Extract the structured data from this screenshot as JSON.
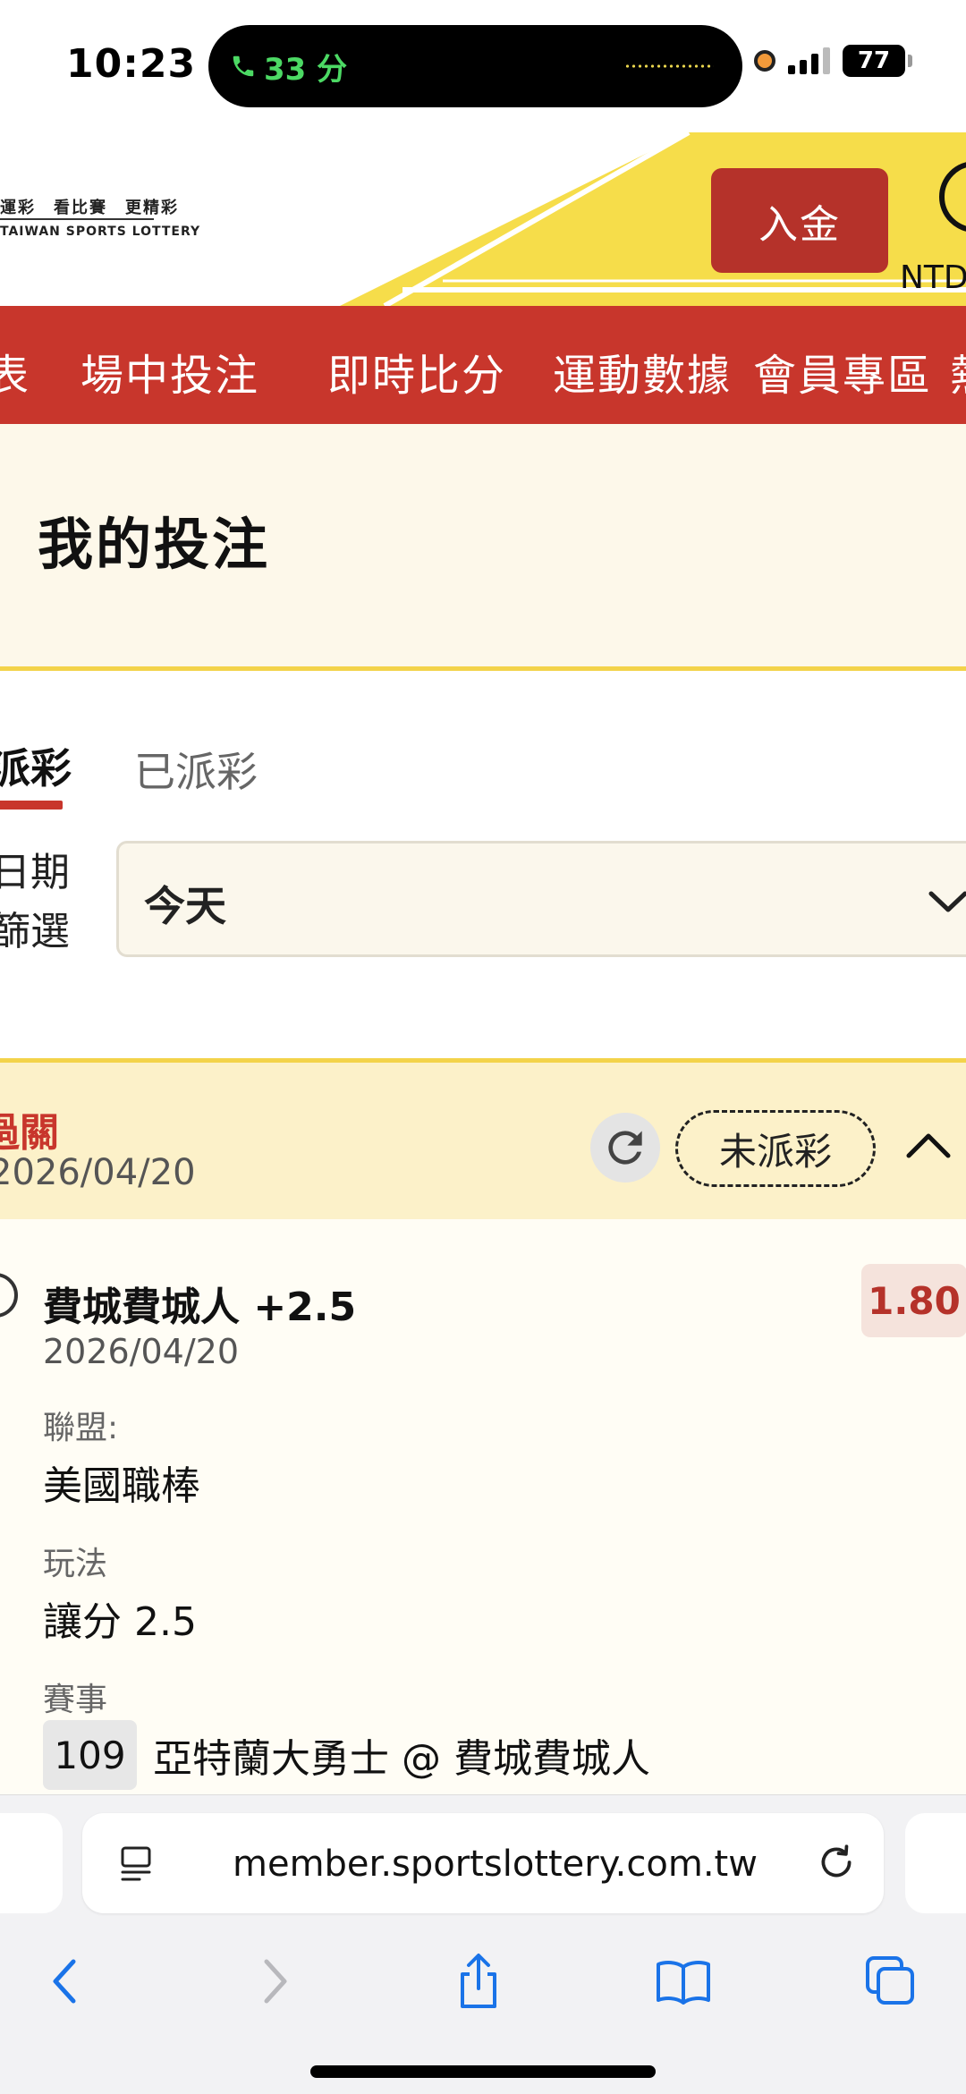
{
  "status_bar": {
    "time": "10:23",
    "call_duration": "33 分",
    "battery": "77"
  },
  "header": {
    "logo_top": "運彩　看比賽　更精彩",
    "logo_bottom": "TAIWAN SPORTS LOTTERY",
    "deposit_label": "入金",
    "currency": "NTD"
  },
  "nav": {
    "items": [
      "表",
      "場中投注",
      "即時比分",
      "運動數據",
      "會員專區",
      "熱"
    ]
  },
  "page": {
    "title": "我的投注"
  },
  "tabs": {
    "active_label": "派彩",
    "inactive_label": "已派彩"
  },
  "filter": {
    "label_line1": "日期",
    "label_line2": "篩選",
    "selected": "今天"
  },
  "bet": {
    "type": "過關",
    "date": "2026/04/20",
    "status": "未派彩",
    "selection": "費城費城人 +2.5",
    "selection_date": "2026/04/20",
    "odds": "1.80",
    "league_label": "聯盟:",
    "league_value": "美國職棒",
    "play_label": "玩法",
    "play_value": "讓分 2.5",
    "event_label": "賽事",
    "event_id": "109",
    "event_name": "亞特蘭大勇士 @ 費城費城人"
  },
  "browser": {
    "url": "member.sportslottery.com.tw"
  },
  "colors": {
    "brand_red": "#c8362c",
    "banner_yellow": "#f6dd4a",
    "cream": "#fdf8ea",
    "odds_red": "#b5322a"
  }
}
